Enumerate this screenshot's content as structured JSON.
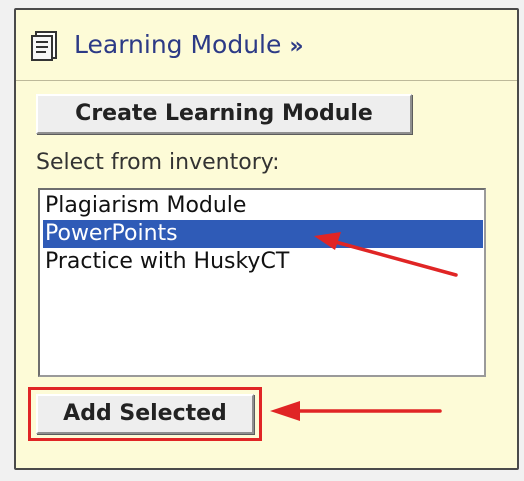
{
  "module": {
    "title": "Learning Module",
    "chevron": "»",
    "icon": "document-icon"
  },
  "buttons": {
    "create": "Create Learning Module",
    "add_selected": "Add Selected"
  },
  "inventory": {
    "label": "Select from inventory:",
    "items": [
      "Plagiarism Module",
      "PowerPoints",
      "Practice with HuskyCT"
    ],
    "selected_index": 1
  },
  "annotations": {
    "arrow_color": "#e02525",
    "highlight_color": "#e02525"
  },
  "colors": {
    "panel_background": "#fdfbd7",
    "selection": "#2f5bb7",
    "title_text": "#2c3a86"
  }
}
